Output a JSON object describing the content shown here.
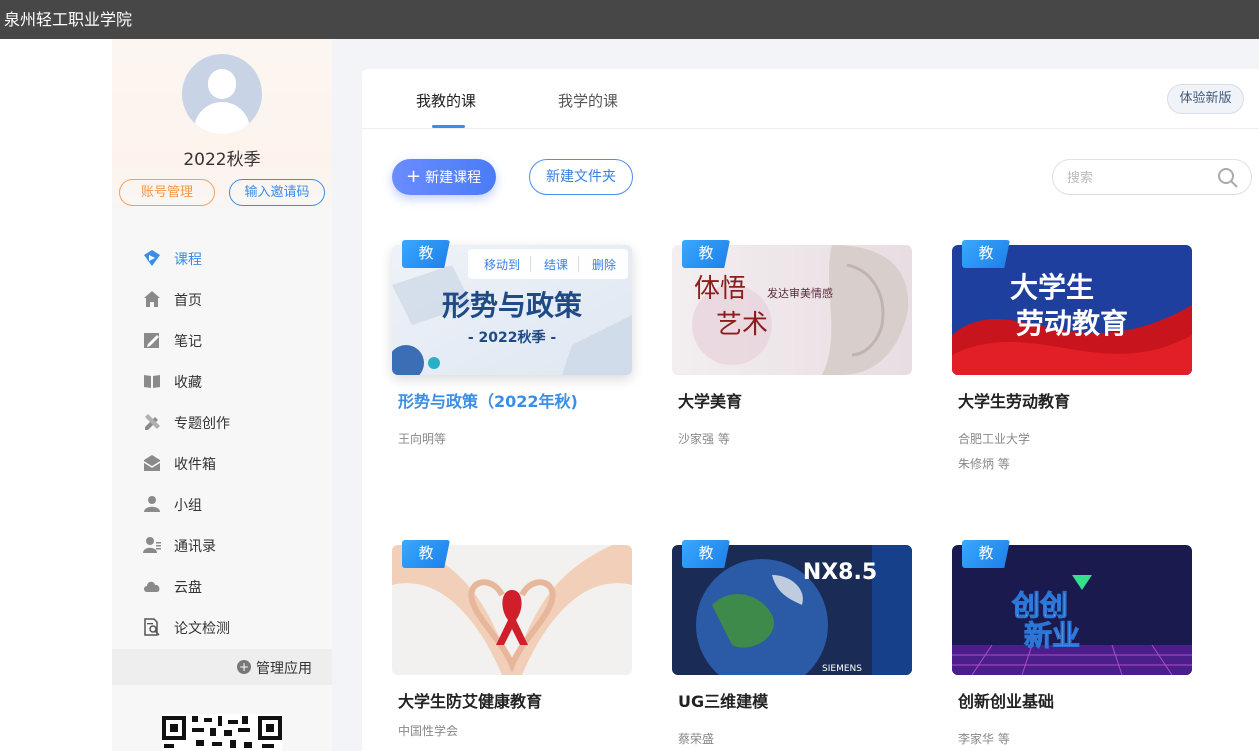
{
  "window": {
    "title": "泉州轻工职业学院"
  },
  "profile": {
    "name": "2022秋季",
    "account_btn": "账号管理",
    "invite_btn": "输入邀请码"
  },
  "menu": [
    {
      "id": "course",
      "label": "课程",
      "icon": "course-icon",
      "active": true
    },
    {
      "id": "home",
      "label": "首页",
      "icon": "home-icon"
    },
    {
      "id": "notes",
      "label": "笔记",
      "icon": "note-icon"
    },
    {
      "id": "fav",
      "label": "收藏",
      "icon": "book-icon"
    },
    {
      "id": "topic",
      "label": "专题创作",
      "icon": "pencil-ruler-icon"
    },
    {
      "id": "inbox",
      "label": "收件箱",
      "icon": "mail-icon"
    },
    {
      "id": "group",
      "label": "小组",
      "icon": "user-icon"
    },
    {
      "id": "contacts",
      "label": "通讯录",
      "icon": "contacts-icon"
    },
    {
      "id": "cloud",
      "label": "云盘",
      "icon": "cloud-icon"
    },
    {
      "id": "thesis",
      "label": "论文检测",
      "icon": "document-search-icon"
    }
  ],
  "manage_apps": "管理应用",
  "tabs": {
    "teach": "我教的课",
    "learn": "我学的课"
  },
  "new_version_btn": "体验新版",
  "toolbar": {
    "new_course": "新建课程",
    "new_folder": "新建文件夹"
  },
  "search": {
    "placeholder": "搜索"
  },
  "badge_label": "教",
  "card_actions": {
    "move": "移动到",
    "finish": "结课",
    "delete": "删除"
  },
  "courses": [
    {
      "title": "形势与政策（2022年秋)",
      "sub1": "王向明等",
      "sub2": "",
      "cover_title": "形势与政策",
      "cover_sub": "- 2022秋季 -"
    },
    {
      "title": "大学美育",
      "sub1": "沙家强 等",
      "sub2": "",
      "cover_title": "体悟",
      "cover_title2": "艺术",
      "cover_sub": "发达审美情感"
    },
    {
      "title": "大学生劳动教育",
      "sub1": "合肥工业大学",
      "sub2": "朱修炳 等",
      "cover_title": "大学生",
      "cover_title2": "劳动教育"
    },
    {
      "title": "大学生防艾健康教育",
      "sub1": "中国性学会",
      "sub2": ""
    },
    {
      "title": "UG三维建模",
      "sub1": "蔡荣盛",
      "sub2": "",
      "cover_title": "NX8.5",
      "cover_sub": "SIEMENS"
    },
    {
      "title": "创新创业基础",
      "sub1": "李家华 等",
      "sub2": "",
      "cover_title": "创创",
      "cover_title2": "新业"
    }
  ],
  "colors": {
    "accent": "#3a8ee6",
    "topbar": "#474747",
    "badge": "#1c7fe8",
    "orange": "#f29748"
  }
}
